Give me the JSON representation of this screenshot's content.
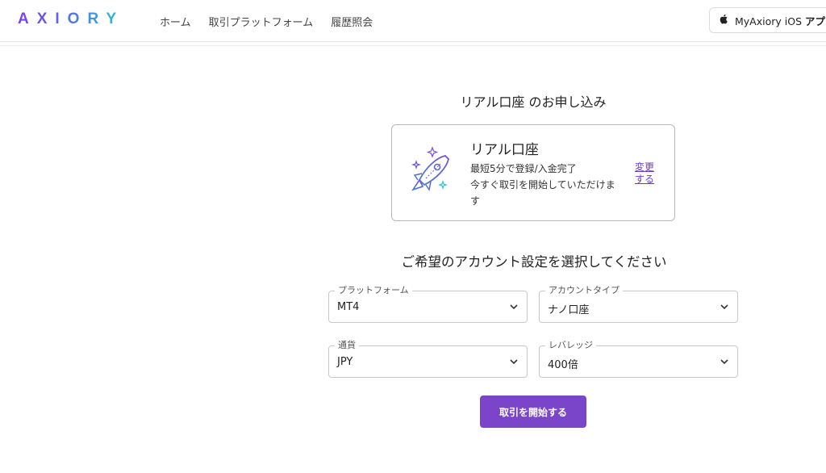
{
  "header": {
    "logo_text": "AXIORY",
    "nav": [
      {
        "label": "ホーム"
      },
      {
        "label": "取引プラットフォーム"
      },
      {
        "label": "履歴照会"
      }
    ],
    "app_button": {
      "text_regular": "MyAxiory iOS ",
      "text_bold": "アプリ",
      "icon": "apple-icon"
    }
  },
  "application": {
    "title": "リアル口座 のお申し込み",
    "account_card": {
      "icon": "rocket-icon",
      "title": "リアル口座",
      "desc_line1": "最短5分で登録/入金完了",
      "desc_line2": "今すぐ取引を開始していただけま",
      "desc_line3": "す",
      "change_link": "変更する"
    },
    "settings_title": "ご希望のアカウント設定を選択してください",
    "fields": {
      "platform": {
        "label": "プラットフォーム",
        "value": "MT4"
      },
      "account_type": {
        "label": "アカウントタイプ",
        "value": "ナノ口座"
      },
      "currency": {
        "label": "通貨",
        "value": "JPY"
      },
      "leverage": {
        "label": "レバレッジ",
        "value": "400倍"
      }
    },
    "start_button": "取引を開始する"
  },
  "colors": {
    "accent": "#7a45c8",
    "link": "#6b3cc9",
    "logo_start": "#7b3fe4",
    "logo_end": "#23c8c8"
  }
}
